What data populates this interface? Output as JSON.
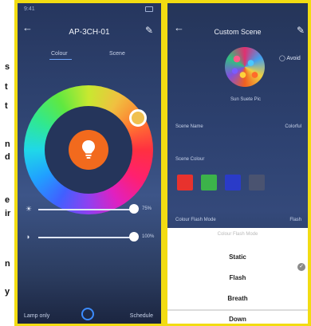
{
  "margin_chars": [
    "s",
    "t",
    "t",
    "n",
    "d",
    "e",
    "ir",
    "n",
    "y"
  ],
  "screen1": {
    "status_time": "9:41",
    "title": "AP-3CH-01",
    "tabs": [
      "Colour",
      "Scene"
    ],
    "brightness_value": "75%",
    "temperature_value": "100%",
    "bottom_left": "Lamp only",
    "bottom_right": "Schedule"
  },
  "screen2": {
    "title": "Custom Scene",
    "avoid_label": "Avoid",
    "scene_caption": "Sun Suete Pic",
    "scene_name_label": "Scene Name",
    "scene_name_value": "Colorful",
    "scene_colour_label": "Scene Colour",
    "colour_flash_label": "Colour Flash Mode",
    "colour_flash_value": "Flash",
    "swatch_colors": [
      "#e8322d",
      "#3cb34a",
      "#2a3bc8",
      "#4a5370"
    ],
    "sheet": {
      "title": "Colour Flash Mode",
      "options": [
        "Static",
        "Flash",
        "Breath",
        "Down"
      ],
      "selected": "Flash"
    }
  }
}
